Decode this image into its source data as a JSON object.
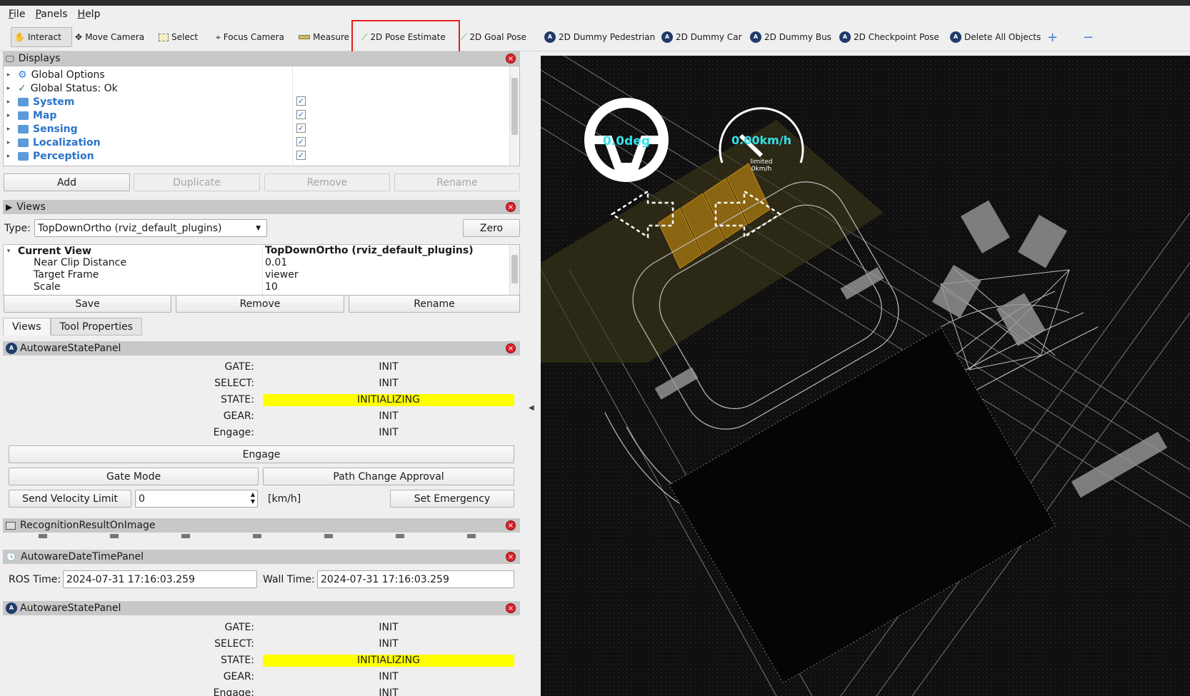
{
  "menu": [
    {
      "label": "File",
      "ul": "F",
      "rest": "ile"
    },
    {
      "label": "Panels",
      "ul": "P",
      "rest": "anels"
    },
    {
      "label": "Help",
      "ul": "H",
      "rest": "elp"
    }
  ],
  "toolbar": {
    "interact": "Interact",
    "move_camera": "Move Camera",
    "select": "Select",
    "focus_camera": "Focus Camera",
    "measure": "Measure",
    "pose_estimate": "2D Pose Estimate",
    "goal_pose": "2D Goal Pose",
    "dummy_pedestrian": "2D Dummy Pedestrian",
    "dummy_car": "2D Dummy Car",
    "dummy_bus": "2D Dummy Bus",
    "checkpoint_pose": "2D Checkpoint Pose",
    "delete_all": "Delete All Objects",
    "plus": "+",
    "minus": "−"
  },
  "displays": {
    "title": "Displays",
    "items": [
      {
        "label": "Global Options"
      },
      {
        "label": "Global Status: Ok"
      },
      {
        "label": "System",
        "checked": "✓"
      },
      {
        "label": "Map",
        "checked": "✓"
      },
      {
        "label": "Sensing",
        "checked": "✓"
      },
      {
        "label": "Localization",
        "checked": "✓"
      },
      {
        "label": "Perception",
        "checked": "✓"
      }
    ],
    "buttons": {
      "add": "Add",
      "duplicate": "Duplicate",
      "remove": "Remove",
      "rename": "Rename"
    }
  },
  "views": {
    "title": "Views",
    "type_label": "Type:",
    "type_value": "TopDownOrtho (rviz_default_plugins)",
    "zero": "Zero",
    "current_view_label": "Current View",
    "current_view_value": "TopDownOrtho (rviz_default_plugins)",
    "props": [
      {
        "k": "Near Clip Distance",
        "v": "0.01"
      },
      {
        "k": "Target Frame",
        "v": "viewer"
      },
      {
        "k": "Scale",
        "v": "10"
      }
    ],
    "buttons": {
      "save": "Save",
      "remove": "Remove",
      "rename": "Rename"
    },
    "tabs": [
      "Views",
      "Tool Properties"
    ]
  },
  "state_panel_1": {
    "title": "AutowareStatePanel",
    "rows": [
      {
        "k": "GATE:",
        "v": "INIT"
      },
      {
        "k": "SELECT:",
        "v": "INIT"
      },
      {
        "k": "STATE:",
        "v": "INITIALIZING"
      },
      {
        "k": "GEAR:",
        "v": "INIT"
      },
      {
        "k": "Engage:",
        "v": "INIT"
      }
    ],
    "engage": "Engage",
    "gate_mode": "Gate Mode",
    "path_change": "Path Change Approval",
    "send_velocity": "Send Velocity Limit",
    "velocity_value": "0",
    "velocity_unit": "[km/h]",
    "set_emergency": "Set Emergency"
  },
  "recognition": {
    "title": "RecognitionResultOnImage"
  },
  "datetime": {
    "title": "AutowareDateTimePanel",
    "ros_label": "ROS Time:",
    "ros_value": "2024-07-31 17:16:03.259",
    "wall_label": "Wall Time:",
    "wall_value": "2024-07-31 17:16:03.259"
  },
  "state_panel_2": {
    "title": "AutowareStatePanel",
    "rows": [
      {
        "k": "GATE:",
        "v": "INIT"
      },
      {
        "k": "SELECT:",
        "v": "INIT"
      },
      {
        "k": "STATE:",
        "v": "INITIALIZING"
      },
      {
        "k": "GEAR:",
        "v": "INIT"
      },
      {
        "k": "Engage:",
        "v": "INIT"
      }
    ]
  },
  "hud": {
    "steering": "0.0deg",
    "speed": "0.00km/h",
    "limit_line1": "limited",
    "limit_line2": "0km/h",
    "accent": "#33e0e8"
  },
  "colors": {
    "state_highlight": "#ffff00",
    "close": "#d9212b",
    "link_blue": "#2a73c9",
    "selection_box": "#e02020"
  }
}
